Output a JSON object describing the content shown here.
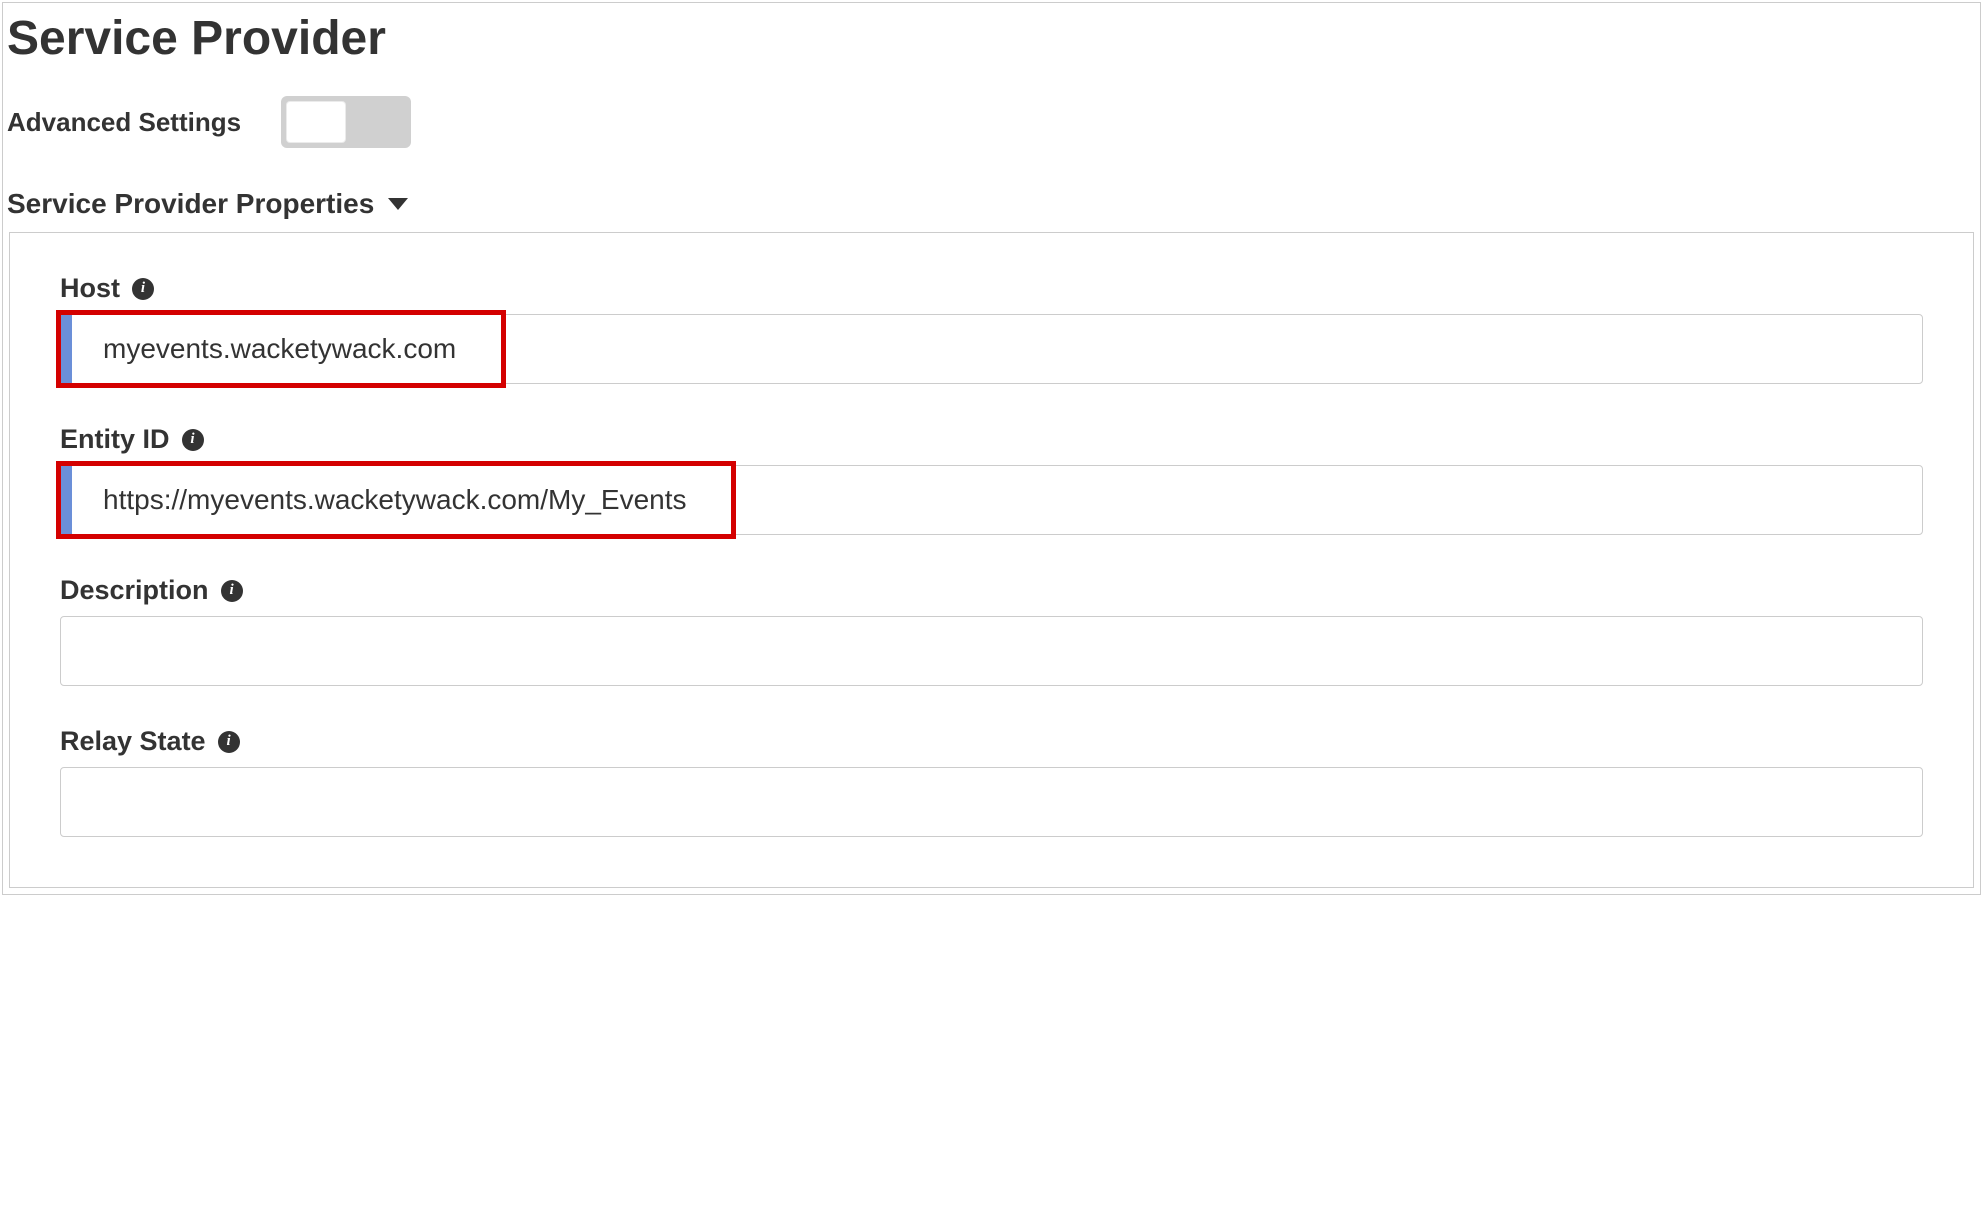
{
  "page": {
    "title": "Service Provider"
  },
  "advanced": {
    "label": "Advanced Settings",
    "enabled": false
  },
  "section": {
    "title": "Service Provider Properties"
  },
  "fields": {
    "host": {
      "label": "Host",
      "value": "myevents.wacketywack.com"
    },
    "entity_id": {
      "label": "Entity ID",
      "value": "https://myevents.wacketywack.com/My_Events"
    },
    "description": {
      "label": "Description",
      "value": ""
    },
    "relay_state": {
      "label": "Relay State",
      "value": ""
    }
  }
}
